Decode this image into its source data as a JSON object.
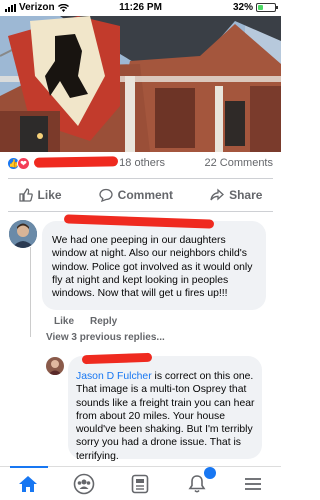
{
  "status_bar": {
    "carrier": "Verizon",
    "time": "11:26 PM",
    "battery_percent": "32%",
    "battery_level": 0.32
  },
  "post": {
    "reactions_text": "d 18 others",
    "comments_count": "22 Comments"
  },
  "action_bar": {
    "like_label": "Like",
    "comment_label": "Comment",
    "share_label": "Share"
  },
  "comments": [
    {
      "text": "We had one peeping in our daughters window at night. Also our neighbors child's window. Police got involved as it would only fly at night and kept looking in peoples windows. Now that will get u fires up!!!",
      "like_label": "Like",
      "reply_label": "Reply"
    }
  ],
  "previous_replies_label": "View 3 previous replies...",
  "reply": {
    "mention": "Jason D Fulcher",
    "text": " is correct on this one.  That image is a multi-ton Osprey that sounds like a freight train you can hear from about 20 miles.  Your house would've been shaking.  But I'm terribly sorry you had a drone issue.  That is terrifying."
  },
  "colors": {
    "facebook_blue": "#1877f2",
    "redaction_red": "#ef2a1f",
    "bubble_gray": "#f0f2f5"
  },
  "icons": [
    "like-reaction-icon",
    "love-reaction-icon",
    "thumbs-up-icon",
    "comment-icon",
    "share-icon",
    "home-icon",
    "groups-icon",
    "news-feed-icon",
    "notifications-icon",
    "menu-icon"
  ]
}
